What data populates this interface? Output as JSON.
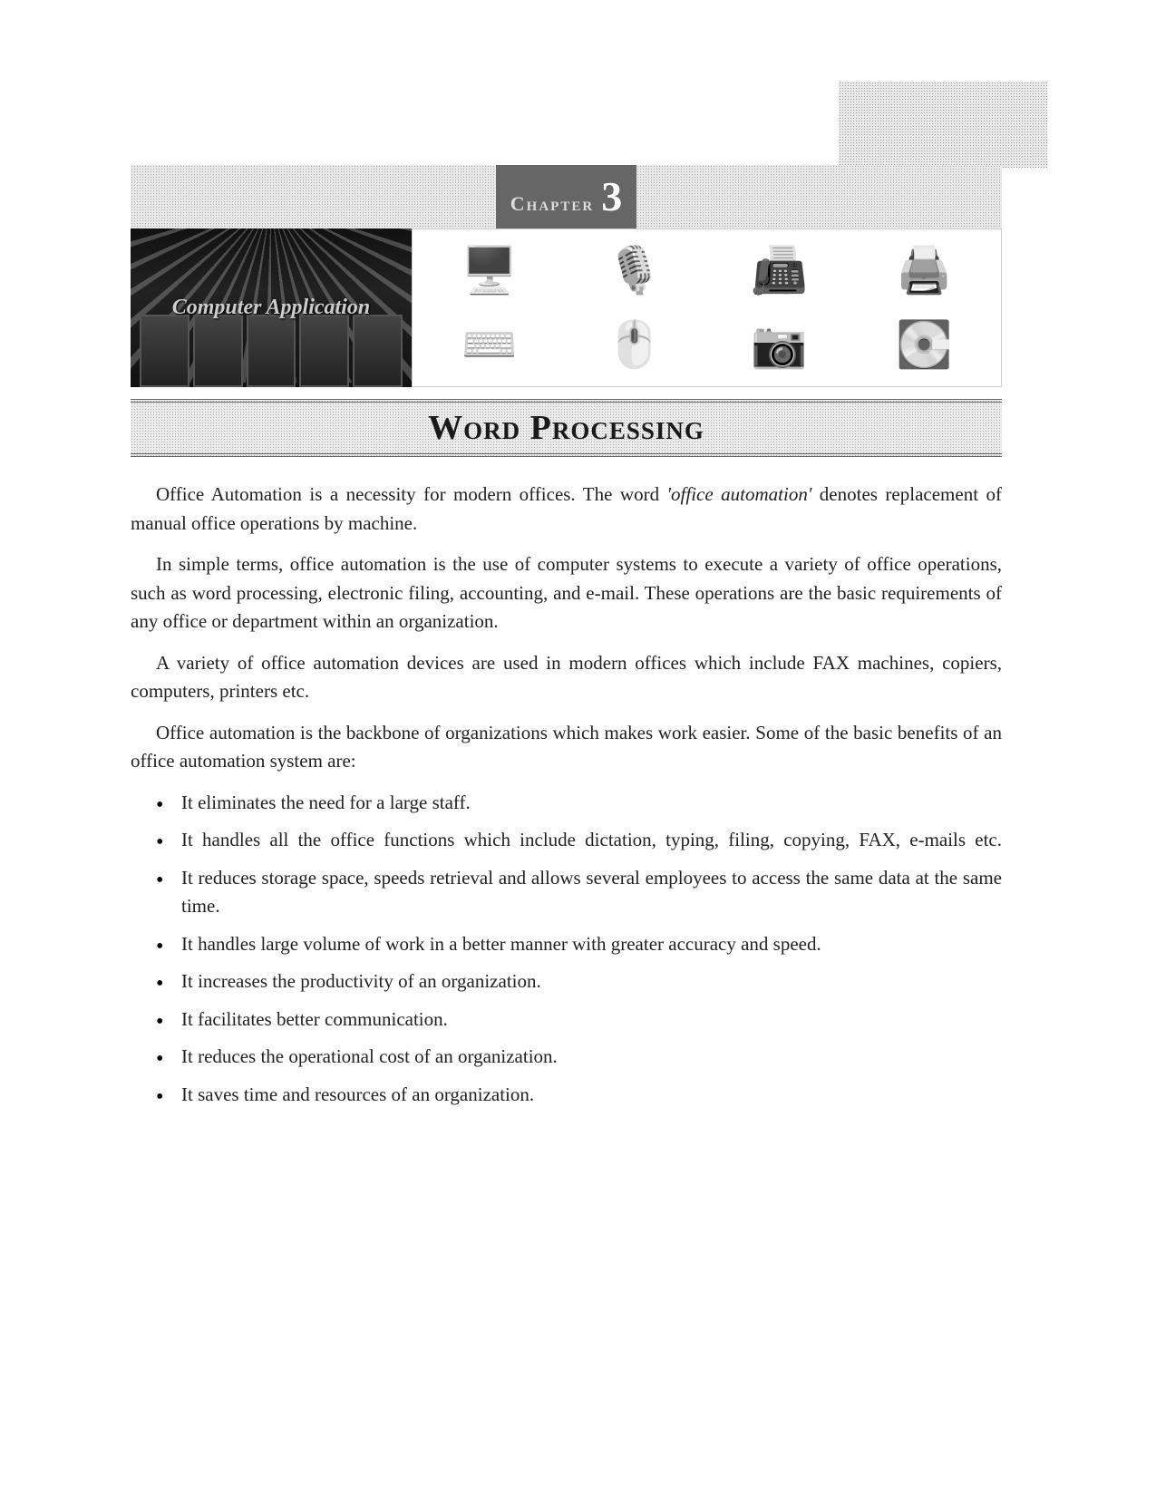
{
  "chapter": {
    "label": "Chapter",
    "number": "3"
  },
  "banner": {
    "subject": "Computer Application"
  },
  "title": "Word Processing",
  "paragraphs": {
    "p1_before_em": "Office Automation is a necessity for modern offices. The word ",
    "p1_em": "'office automation'",
    "p1_after_em": " denotes replacement of manual office operations by machine.",
    "p2": "In simple terms, office automation is the use of computer systems to execute a variety of office operations, such as word processing, electronic filing, accounting, and e-mail. These operations are the basic requirements of any office or department within an organization.",
    "p3": "A variety of office automation devices are used in modern offices which include FAX machines, copiers, computers, printers etc.",
    "p4": "Office automation is the backbone of organizations which makes work easier. Some of the basic benefits of an office automation system are:"
  },
  "bullets": [
    "It eliminates the need for a large staff.",
    "It handles all the office functions which include dictation, typing, filing, copying, FAX, e-mails etc.",
    "It reduces storage space, speeds retrieval and allows several employees to access the same data at the same time.",
    "It handles large volume of work in a better manner with greater accuracy and speed.",
    "It increases the productivity of an organization.",
    "It facilitates better communication.",
    "It reduces the operational cost of an organization.",
    "It saves time and resources of an organization."
  ],
  "devices": {
    "d0": "🖥️",
    "d1": "🎙️",
    "d2": "📠",
    "d3": "🖨️",
    "d4": "⌨️",
    "d5": "🖱️",
    "d6": "📷",
    "d7": "💽"
  }
}
